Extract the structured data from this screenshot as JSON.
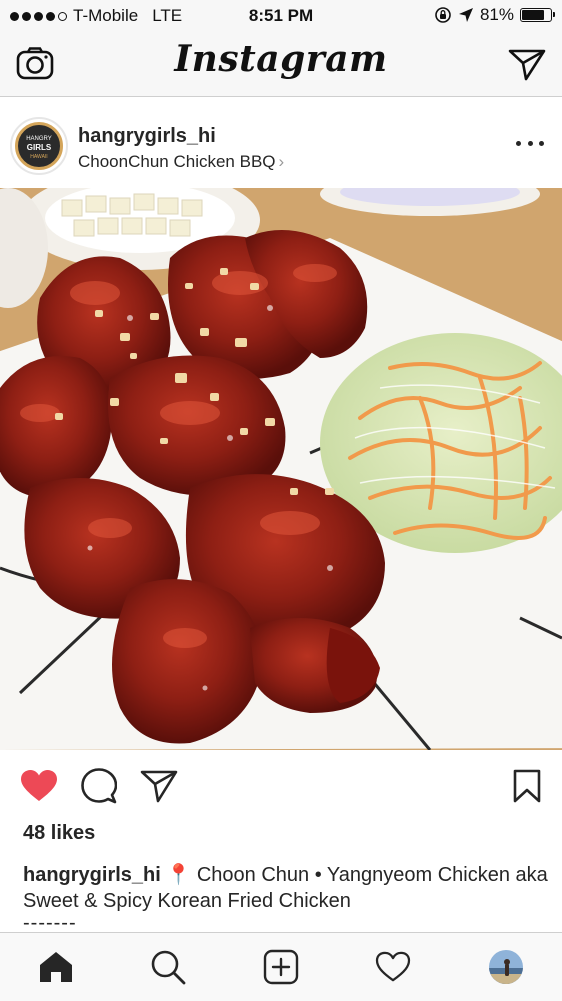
{
  "status_bar": {
    "carrier": "T-Mobile",
    "network": "LTE",
    "time": "8:51 PM",
    "battery_text": "81%",
    "battery_level": 0.81,
    "signal_bars": 4,
    "signal_total": 5
  },
  "nav": {
    "title": "Instagram",
    "camera_icon": "camera-icon",
    "direct_icon": "paper-plane-icon"
  },
  "post": {
    "username": "hangrygirls_hi",
    "location": "ChoonChun Chicken BBQ",
    "location_chevron": "›",
    "avatar_text": [
      "HANGRY",
      "GIRLS",
      "HAWAII"
    ],
    "more_icon": "more-horizontal-icon",
    "photo_alt": "photo",
    "liked": true,
    "like_color": "#ed4956"
  },
  "actions": {
    "like_icon": "heart-filled-icon",
    "comment_icon": "comment-bubble-icon",
    "share_icon": "paper-plane-icon",
    "save_icon": "bookmark-icon"
  },
  "likes_text": "48 likes",
  "caption": {
    "username": "hangrygirls_hi",
    "pin": "📍",
    "text": "Choon Chun • Yangnyeom Chicken aka Sweet & Spicy Korean Fried Chicken",
    "divider": "-------"
  },
  "tab_bar": {
    "items": [
      {
        "name": "home",
        "icon": "home-icon",
        "active": true
      },
      {
        "name": "search",
        "icon": "search-icon",
        "active": false
      },
      {
        "name": "add",
        "icon": "add-post-icon",
        "active": false
      },
      {
        "name": "activity",
        "icon": "heart-outline-icon",
        "active": false
      },
      {
        "name": "profile",
        "icon": "profile-avatar-icon",
        "active": false
      }
    ]
  },
  "colors": {
    "like_red": "#ed4956",
    "text": "#262626",
    "bar_bg": "#f7f7f7"
  }
}
